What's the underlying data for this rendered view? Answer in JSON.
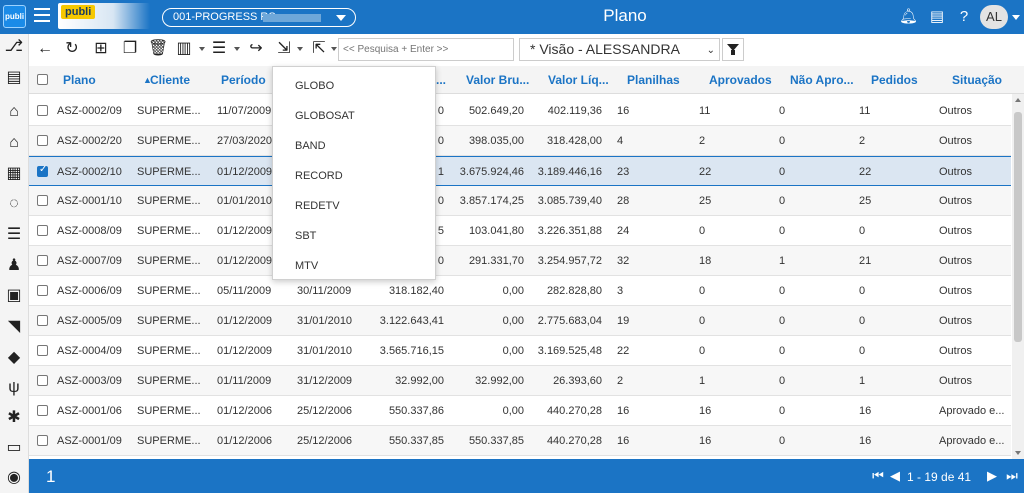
{
  "app": {
    "logo_text": "publi",
    "brand_badge": "publi",
    "company_selector": "001-PROGRESS RS -",
    "page_title": "Plano",
    "user_initials": "AL"
  },
  "toolbar": {
    "search_placeholder": "<< Pesquisa + Enter >>",
    "view_label": "* Visão - ALESSANDRA"
  },
  "dropdown": {
    "items": [
      "GLOBO",
      "GLOBOSAT",
      "BAND",
      "RECORD",
      "REDETV",
      "SBT",
      "MTV"
    ]
  },
  "table": {
    "columns": [
      "Plano",
      "Cliente",
      "Período",
      "...",
      "Valor Bru...",
      "Valor Líq...",
      "Planilhas",
      "Aprovados",
      "Não Apro...",
      "Pedidos",
      "Situação"
    ],
    "sort_indicator": "▲",
    "rows": [
      {
        "checked": false,
        "plano": "ASZ-0002/09",
        "cliente": "SUPERME...",
        "inicio": "11/07/2009",
        "fim": "",
        "valor": "0",
        "bruto": "502.649,20",
        "liquido": "402.119,36",
        "planilhas": "16",
        "aprovados": "11",
        "nao_aprov": "0",
        "pedidos": "11",
        "situacao": "Outros"
      },
      {
        "checked": false,
        "plano": "ASZ-0002/20",
        "cliente": "SUPERME...",
        "inicio": "27/03/2020",
        "fim": "",
        "valor": "0",
        "bruto": "398.035,00",
        "liquido": "318.428,00",
        "planilhas": "4",
        "aprovados": "2",
        "nao_aprov": "0",
        "pedidos": "2",
        "situacao": "Outros"
      },
      {
        "checked": true,
        "plano": "ASZ-0002/10",
        "cliente": "SUPERME...",
        "inicio": "01/12/2009",
        "fim": "",
        "valor": "1",
        "bruto": "3.675.924,46",
        "liquido": "3.189.446,16",
        "planilhas": "23",
        "aprovados": "22",
        "nao_aprov": "0",
        "pedidos": "22",
        "situacao": "Outros"
      },
      {
        "checked": false,
        "plano": "ASZ-0001/10",
        "cliente": "SUPERME...",
        "inicio": "01/01/2010",
        "fim": "",
        "valor": "0",
        "bruto": "3.857.174,25",
        "liquido": "3.085.739,40",
        "planilhas": "28",
        "aprovados": "25",
        "nao_aprov": "0",
        "pedidos": "25",
        "situacao": "Outros"
      },
      {
        "checked": false,
        "plano": "ASZ-0008/09",
        "cliente": "SUPERME...",
        "inicio": "01/12/2009",
        "fim": "",
        "valor": "5",
        "bruto": "103.041,80",
        "liquido": "3.226.351,88",
        "planilhas": "24",
        "aprovados": "0",
        "nao_aprov": "0",
        "pedidos": "0",
        "situacao": "Outros"
      },
      {
        "checked": false,
        "plano": "ASZ-0007/09",
        "cliente": "SUPERME...",
        "inicio": "01/12/2009",
        "fim": "",
        "valor": "0",
        "bruto": "291.331,70",
        "liquido": "3.254.957,72",
        "planilhas": "32",
        "aprovados": "18",
        "nao_aprov": "1",
        "pedidos": "21",
        "situacao": "Outros"
      },
      {
        "checked": false,
        "plano": "ASZ-0006/09",
        "cliente": "SUPERME...",
        "inicio": "05/11/2009",
        "fim": "30/11/2009",
        "valor": "318.182,40",
        "bruto": "0,00",
        "liquido": "282.828,80",
        "planilhas": "3",
        "aprovados": "0",
        "nao_aprov": "0",
        "pedidos": "0",
        "situacao": "Outros"
      },
      {
        "checked": false,
        "plano": "ASZ-0005/09",
        "cliente": "SUPERME...",
        "inicio": "01/12/2009",
        "fim": "31/01/2010",
        "valor": "3.122.643,41",
        "bruto": "0,00",
        "liquido": "2.775.683,04",
        "planilhas": "19",
        "aprovados": "0",
        "nao_aprov": "0",
        "pedidos": "0",
        "situacao": "Outros"
      },
      {
        "checked": false,
        "plano": "ASZ-0004/09",
        "cliente": "SUPERME...",
        "inicio": "01/12/2009",
        "fim": "31/01/2010",
        "valor": "3.565.716,15",
        "bruto": "0,00",
        "liquido": "3.169.525,48",
        "planilhas": "22",
        "aprovados": "0",
        "nao_aprov": "0",
        "pedidos": "0",
        "situacao": "Outros"
      },
      {
        "checked": false,
        "plano": "ASZ-0003/09",
        "cliente": "SUPERME...",
        "inicio": "01/11/2009",
        "fim": "31/12/2009",
        "valor": "32.992,00",
        "bruto": "32.992,00",
        "liquido": "26.393,60",
        "planilhas": "2",
        "aprovados": "1",
        "nao_aprov": "0",
        "pedidos": "1",
        "situacao": "Outros"
      },
      {
        "checked": false,
        "plano": "ASZ-0001/06",
        "cliente": "SUPERME...",
        "inicio": "01/12/2006",
        "fim": "25/12/2006",
        "valor": "550.337,86",
        "bruto": "0,00",
        "liquido": "440.270,28",
        "planilhas": "16",
        "aprovados": "16",
        "nao_aprov": "0",
        "pedidos": "16",
        "situacao": "Aprovado e..."
      },
      {
        "checked": false,
        "plano": "ASZ-0001/09",
        "cliente": "SUPERME...",
        "inicio": "01/12/2006",
        "fim": "25/12/2006",
        "valor": "550.337,85",
        "bruto": "550.337,85",
        "liquido": "440.270,28",
        "planilhas": "16",
        "aprovados": "16",
        "nao_aprov": "0",
        "pedidos": "16",
        "situacao": "Aprovado e..."
      }
    ]
  },
  "footer": {
    "page_number": "1",
    "pager_text": "1 - 19 de 41"
  },
  "colors": {
    "primary": "#1b74c5",
    "header_text": "#1b74c5",
    "selected_row": "#dbe6f2",
    "brand_badge": "#f6c800"
  }
}
